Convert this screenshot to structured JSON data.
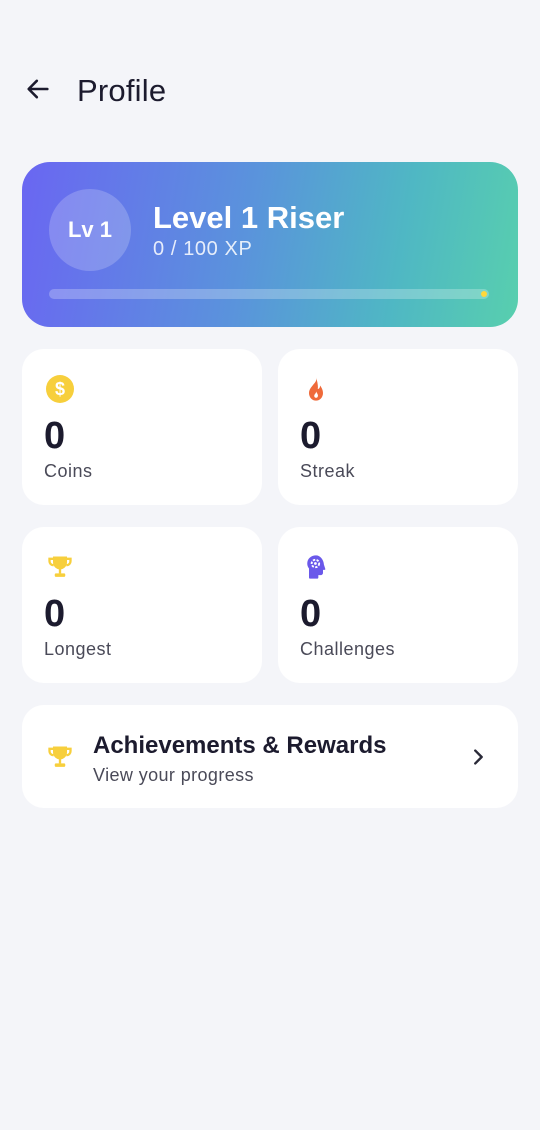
{
  "header": {
    "title": "Profile",
    "back_icon": "arrow-left-icon"
  },
  "level": {
    "badge": "Lv 1",
    "title": "Level 1 Riser",
    "xp_text": "0 / 100 XP",
    "progress": 0.0,
    "gradient_start": "#6a66f2",
    "gradient_end": "#58cfae",
    "progress_color": "#ffd83a"
  },
  "stats": [
    {
      "value": "0",
      "label": "Coins",
      "icon": "coin-icon",
      "color": "#f7cf3c"
    },
    {
      "value": "0",
      "label": "Streak",
      "icon": "fire-icon",
      "color": "#ef6a3a"
    },
    {
      "value": "0",
      "label": "Longest",
      "icon": "trophy-icon",
      "color": "#f7cf3c"
    },
    {
      "value": "0",
      "label": "Challenges",
      "icon": "brain-gear-icon",
      "color": "#6a58ea"
    }
  ],
  "achievements": {
    "title": "Achievements & Rewards",
    "subtitle": "View your progress",
    "icon": "trophy-icon",
    "chevron": "chevron-right-icon"
  }
}
